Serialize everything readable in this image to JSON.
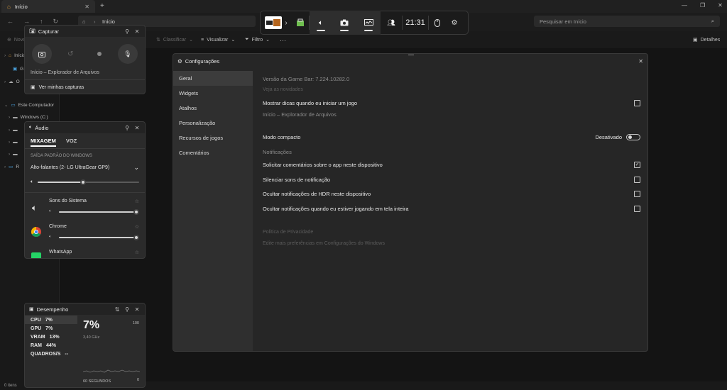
{
  "explorer": {
    "tab_title": "Início",
    "address": "Início",
    "search_placeholder": "Pesquisar em Início",
    "toolbar": {
      "new": "Novo",
      "sort": "Classificar",
      "view": "Visualizar",
      "filter": "Filtro",
      "more": "···",
      "details": "Detalhes"
    },
    "tree": {
      "home": "Início",
      "gallery": "G",
      "onedrive": "O",
      "this_pc": "Este Computador",
      "windows_c": "Windows (C:)",
      "network": "R"
    },
    "status": "0 itens"
  },
  "gamebar": {
    "time": "21:31"
  },
  "capture": {
    "title": "Capturar",
    "source": "Início – Explorador de Arquivos",
    "view_captures": "Ver minhas capturas"
  },
  "audio": {
    "title": "Áudio",
    "tabs": [
      "MIXAGEM",
      "VOZ"
    ],
    "output_label": "SAÍDA PADRÃO DO WINDOWS",
    "device": "Alto-falantes (2- LG UltraGear GP9)",
    "master_volume": 0.45,
    "apps": [
      {
        "name": "Sons do Sistema",
        "volume": 1.0
      },
      {
        "name": "Chrome",
        "volume": 1.0
      },
      {
        "name": "WhatsApp",
        "volume": 1.0
      }
    ]
  },
  "performance": {
    "title": "Desempenho",
    "metrics": [
      {
        "label": "CPU",
        "value": "7%"
      },
      {
        "label": "GPU",
        "value": "7%"
      },
      {
        "label": "VRAM",
        "value": "13%"
      },
      {
        "label": "RAM",
        "value": "44%"
      },
      {
        "label": "QUADROS/S",
        "value": "--"
      }
    ],
    "big_value": "7%",
    "frequency": "3,40 GHz",
    "max": "100",
    "min": "0",
    "duration": "60 SEGUNDOS"
  },
  "settings": {
    "title": "Configurações",
    "nav": [
      "Geral",
      "Widgets",
      "Atalhos",
      "Personalização",
      "Recursos de jogos",
      "Comentários"
    ],
    "version": "Versão da Game Bar: 7.224.10282.0",
    "whats_new": "Veja as novidades",
    "show_tips": "Mostrar dicas quando eu iniciar um jogo",
    "current_app": "Início – Explorador de Arquivos",
    "compact_mode": "Modo compacto",
    "compact_state": "Desativado",
    "notifications_header": "Notificações",
    "notif_items": [
      {
        "label": "Solicitar comentários sobre o app neste dispositivo",
        "checked": true
      },
      {
        "label": "Silenciar sons de notificação",
        "checked": false
      },
      {
        "label": "Ocultar notificações de HDR neste dispositivo",
        "checked": false
      },
      {
        "label": "Ocultar notificações quando eu estiver jogando em tela inteira",
        "checked": false
      }
    ],
    "privacy": "Política de Privacidade",
    "edit_more": "Edite mais preferências em Configurações do Windows"
  }
}
